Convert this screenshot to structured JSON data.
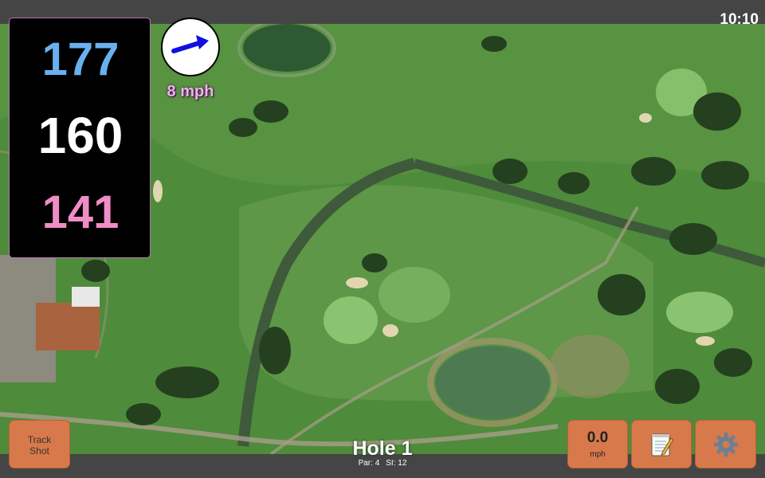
{
  "status_bar": {
    "time": "10:10"
  },
  "distances": {
    "back": "177",
    "middle": "160",
    "front": "141"
  },
  "wind": {
    "speed": "8 mph",
    "direction_icon": "arrow-right-icon"
  },
  "hole": {
    "title": "Hole 1",
    "par": "Par: 4",
    "stroke_index": "SI: 12"
  },
  "buttons": {
    "track_shot_line1": "Track",
    "track_shot_line2": "Shot",
    "speed_value": "0.0",
    "speed_unit": "mph",
    "notes_icon": "notepad-icon",
    "settings_icon": "gear-icon"
  },
  "colors": {
    "back_distance": "#6ab0f0",
    "middle_distance": "#ffffff",
    "front_distance": "#f08cc8",
    "button": "#d8794c"
  }
}
